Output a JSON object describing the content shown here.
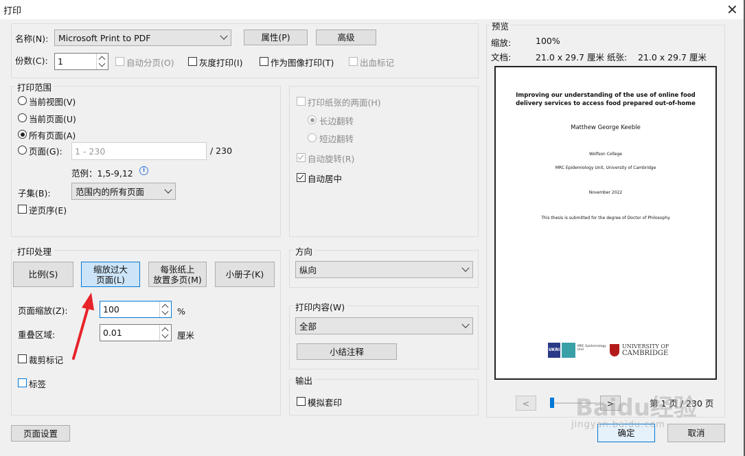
{
  "window": {
    "title": "打印",
    "close_glyph": "✕"
  },
  "printer": {
    "name_label": "名称(N):",
    "name_value": "Microsoft Print to PDF",
    "properties_button": "属性(P)",
    "advanced_button": "高级",
    "copies_label": "份数(C):",
    "copies_value": "1",
    "collate_label": "自动分页(O)",
    "grayscale_label": "灰度打印(I)",
    "print_as_image_label": "作为图像打印(T)",
    "bleed_marks_label": "出血标记"
  },
  "print_range": {
    "title": "打印范围",
    "current_view": "当前视图(V)",
    "current_page": "当前页面(U)",
    "all_pages": "所有页面(A)",
    "pages": "页面(G):",
    "pages_placeholder": "1 - 230",
    "pages_total": "/ 230",
    "example": "范例：1,5-9,12",
    "subset_label": "子集(B):",
    "subset_value": "范围内的所有页面",
    "reverse_label": "逆页序(E)"
  },
  "duplex": {
    "both_sides": "打印纸张的两面(H)",
    "long_edge": "长边翻转",
    "short_edge": "短边翻转",
    "auto_rotate": "自动旋转(R)",
    "auto_center": "自动居中"
  },
  "handling": {
    "title": "打印处理",
    "scale_button": "比例(S)",
    "shrink_button": "缩放过大\n页面(L)",
    "multiple_button": "每张纸上\n放置多页(M)",
    "booklet_button": "小册子(K)",
    "zoom_label": "页面缩放(Z):",
    "zoom_value": "100",
    "zoom_unit": "%",
    "overlap_label": "重叠区域:",
    "overlap_value": "0.01",
    "overlap_unit": "厘米",
    "crop_marks": "裁剪标记",
    "labels": "标签"
  },
  "orientation": {
    "title": "方向",
    "value": "纵向"
  },
  "content": {
    "title": "打印内容(W)",
    "value": "全部",
    "summarize_button": "小结注释"
  },
  "output": {
    "title": "输出",
    "simulate_overprint": "模拟套印"
  },
  "preview": {
    "title": "预览",
    "scale_label": "缩放:",
    "scale_value": "100%",
    "doc_label": "文档:",
    "doc_value": "21.0 x 29.7 厘米",
    "paper_label": "纸张:",
    "paper_value": "21.0 x 29.7 厘米",
    "page": {
      "title_line1": "Improving our understanding of the use of online food",
      "title_line2": "delivery services to access food prepared out-of-home",
      "author": "Matthew George Keeble",
      "college": "Wolfson College",
      "unit": "MRC Epidemiology Unit, University of Cambridge",
      "date": "November 2022",
      "degree": "This thesis is submitted for the degree of Doctor of Philosophy",
      "ukri_logo": "UKRI",
      "mrc_logo": "MRC Epidemiology Unit",
      "cambridge_logo_line1": "UNIVERSITY OF",
      "cambridge_logo_line2": "CAMBRIDGE"
    },
    "prev_button": "<",
    "next_button": ">",
    "page_indicator": "第 1 页 / 230 页"
  },
  "footer": {
    "page_setup": "页面设置",
    "ok": "确定",
    "cancel": "取消"
  },
  "watermark": {
    "text": "Baidu经验",
    "subtext": "jingyan.baidu.com"
  },
  "colors": {
    "accent": "#0078d7",
    "arrow": "#e8232a"
  }
}
